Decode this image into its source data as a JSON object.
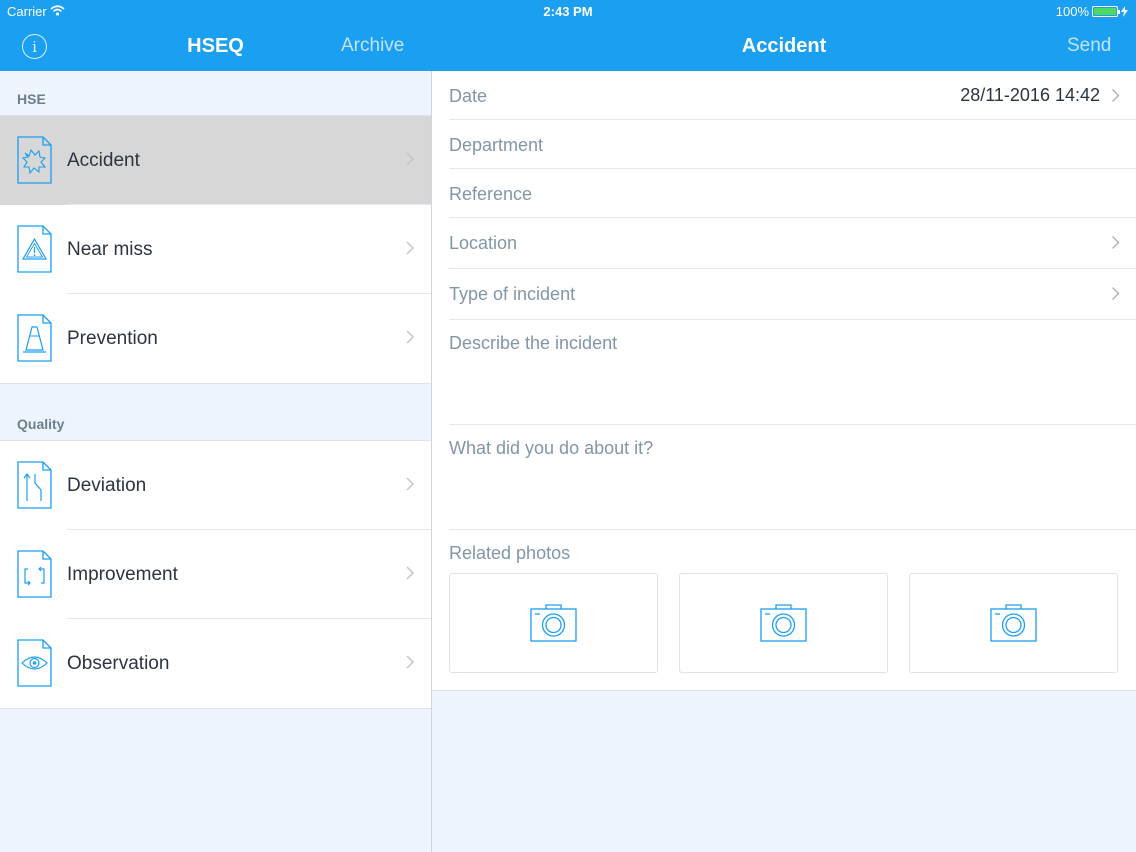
{
  "status_bar": {
    "carrier": "Carrier",
    "time": "2:43 PM",
    "battery": "100%",
    "battery_level": 1.0
  },
  "master": {
    "title": "HSEQ",
    "archive_label": "Archive",
    "info_icon": "info-icon",
    "sections": [
      {
        "header": "HSE",
        "items": [
          {
            "label": "Accident",
            "icon": "accident-doc-icon",
            "selected": true
          },
          {
            "label": "Near miss",
            "icon": "warning-doc-icon"
          },
          {
            "label": "Prevention",
            "icon": "cone-doc-icon"
          }
        ]
      },
      {
        "header": "Quality",
        "items": [
          {
            "label": "Deviation",
            "icon": "deviation-doc-icon"
          },
          {
            "label": "Improvement",
            "icon": "improvement-doc-icon"
          },
          {
            "label": "Observation",
            "icon": "eye-doc-icon"
          }
        ]
      }
    ]
  },
  "detail": {
    "title": "Accident",
    "send_label": "Send",
    "fields": {
      "date_label": "Date",
      "date_value": "28/11-2016 14:42",
      "department_label": "Department",
      "reference_label": "Reference",
      "location_label": "Location",
      "type_label": "Type of incident",
      "describe_label": "Describe the incident",
      "action_label": "What did you do about it?"
    },
    "photos_label": "Related photos",
    "photo_icon": "camera-icon"
  },
  "colors": {
    "accent": "#1b9ff0",
    "icon_blue": "#1b9ff0",
    "selected_row": "#d7d7d7",
    "background": "#eef4fb"
  }
}
